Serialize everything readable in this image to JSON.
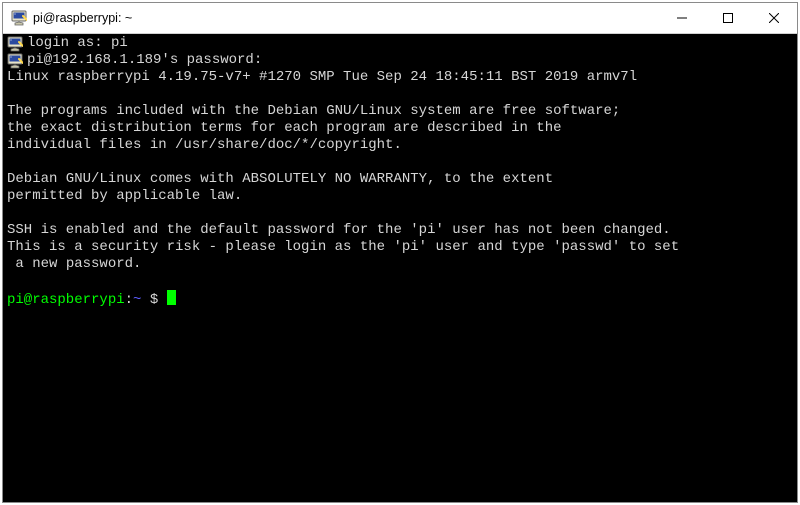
{
  "window": {
    "title": "pi@raspberrypi: ~"
  },
  "session": {
    "login_prompt": "login as: ",
    "login_user": "pi",
    "password_prompt": "pi@192.168.1.189's password:",
    "banner_line1": "Linux raspberrypi 4.19.75-v7+ #1270 SMP Tue Sep 24 18:45:11 BST 2019 armv7l",
    "motd_line1": "The programs included with the Debian GNU/Linux system are free software;",
    "motd_line2": "the exact distribution terms for each program are described in the",
    "motd_line3": "individual files in /usr/share/doc/*/copyright.",
    "motd_line4": "Debian GNU/Linux comes with ABSOLUTELY NO WARRANTY, to the extent",
    "motd_line5": "permitted by applicable law.",
    "ssh_warn1": "SSH is enabled and the default password for the 'pi' user has not been changed.",
    "ssh_warn2": "This is a security risk - please login as the 'pi' user and type 'passwd' to set",
    "ssh_warn3": " a new password.",
    "prompt_user_host": "pi@raspberrypi",
    "prompt_sep": ":",
    "prompt_cwd": "~",
    "prompt_dollar": " $ "
  }
}
